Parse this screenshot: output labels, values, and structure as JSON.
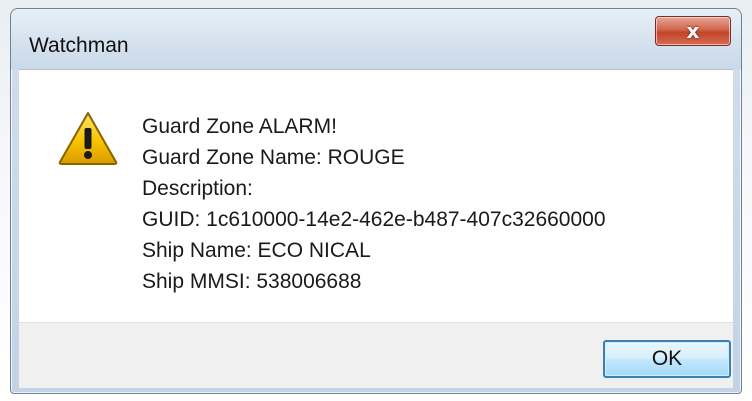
{
  "window": {
    "title": "Watchman",
    "close_label": "x"
  },
  "dialog": {
    "icon": "warning-icon",
    "lines": {
      "l1": "Guard Zone ALARM!",
      "l2": "Guard Zone Name: ROUGE",
      "l3": "Description:",
      "l4": "GUID: 1c610000-14e2-462e-b487-407c32660000",
      "l5": "Ship Name: ECO NICAL",
      "l6": "Ship MMSI: 538006688"
    }
  },
  "buttons": {
    "ok_label": "OK"
  },
  "colors": {
    "close_red": "#c0452b",
    "ok_blue": "#3c7fb1",
    "warning_yellow": "#f6c400"
  }
}
